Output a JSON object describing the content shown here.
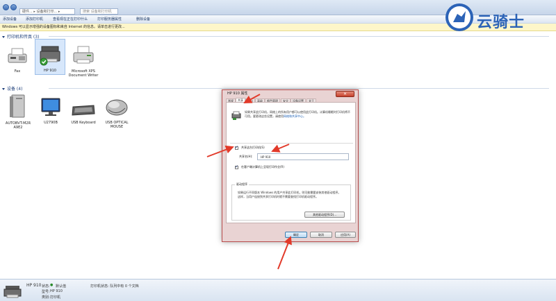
{
  "window": {
    "address": "硬件... ▸ 设备和打印... ▸",
    "search_placeholder": "搜索 设备和打印机"
  },
  "commands": [
    "添加设备",
    "添加打印机",
    "查看现在正在打印什么",
    "打印服务器属性",
    "删除设备"
  ],
  "infobar": "Windows 可以显示增强的设备图标和来自 Internet 的信息。请单击进行更改...",
  "printers_section": {
    "title": "打印机和传真 (3)",
    "items": [
      {
        "label": "Fax"
      },
      {
        "label": "HP 910"
      },
      {
        "label": "Microsoft XPS Document Writer"
      }
    ]
  },
  "devices_section": {
    "title": "设备 (4)",
    "items": [
      {
        "label": "AUTOBVT-M2R A9E2"
      },
      {
        "label": "U2790B"
      },
      {
        "label": "USB Keyboard"
      },
      {
        "label": "USB OPTICAL MOUSE"
      }
    ]
  },
  "dialog": {
    "title": "HP 910 属性",
    "close": "✕",
    "tabs": [
      "常规",
      "共享",
      "端口",
      "高级",
      "颜色管理",
      "安全",
      "设备设置",
      "关于"
    ],
    "active_tab": "共享",
    "description": "如果共享此打印机，网络上的所有用户都可以使用此打印机。计算机睡眠时打印机将不可用。要更改这些设置，请使用",
    "description_link": "网络和共享中心。",
    "share_checkbox": "共享这台打印机(S)",
    "share_name_label": "共享名(H):",
    "share_name_value": "HP 910",
    "render_checkbox": "在客户端计算机上呈现打印作业(R)",
    "drivers_title": "驱动程序",
    "drivers_text": "如果运行不同版本 Windows 的用户共享此打印机，则可能需要安装其他驱动程序。这样，当用户连接到共享打印机时就不需要查找打印机驱动程序。",
    "additional_drivers_button": "其他驱动程序(D)...",
    "ok_button": "确定",
    "cancel_button": "取消",
    "apply_button": "应用(A)"
  },
  "statusbar": {
    "name": "HP 910",
    "state_label": "状态:",
    "state_value": "默认值",
    "model_label": "型号:",
    "model_value": "HP 910",
    "category_label": "类别:",
    "category_value": "打印机",
    "print_status": "打印机状态: 队列中有 0 个文档"
  },
  "watermark": {
    "text": "云骑士"
  },
  "colors": {
    "dialog_border": "#b84b4b",
    "arrow": "#e23a2a",
    "accent": "#2c63b7"
  }
}
